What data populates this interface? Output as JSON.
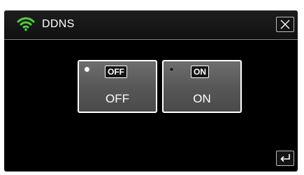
{
  "header": {
    "title": "DDNS",
    "wifi_icon": "wifi-icon",
    "wifi_color": "#4cd23c",
    "close_icon": "close-icon"
  },
  "options": [
    {
      "icon_text": "OFF",
      "label": "OFF",
      "selected": true
    },
    {
      "icon_text": "ON",
      "label": "ON",
      "selected": false
    }
  ],
  "footer": {
    "back_icon": "return-icon"
  }
}
